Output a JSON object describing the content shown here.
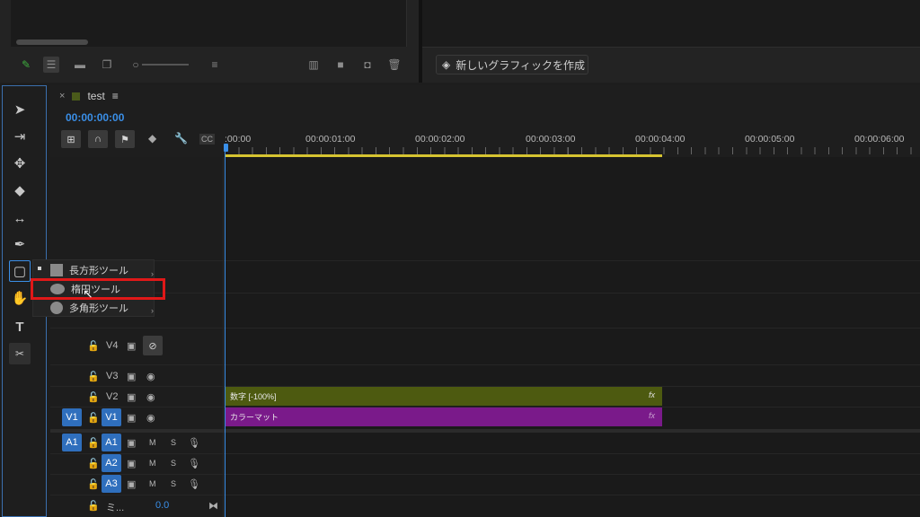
{
  "top_right": {
    "new_graphic_label": "新しいグラフィックを作成"
  },
  "sequence": {
    "tab_name": "test",
    "close": "×",
    "menu": "≡",
    "timecode": "00:00:00:00"
  },
  "ruler": {
    "labels": [
      ":00:00",
      "00:00:01:00",
      "00:00:02:00",
      "00:00:03:00",
      "00:00:04:00",
      "00:00:05:00",
      "00:00:06:00"
    ]
  },
  "tools_flyout": {
    "items": [
      {
        "label": "長方形ツール",
        "icon": "rectangle-icon",
        "selected": true
      },
      {
        "label": "楕円ツール",
        "icon": "ellipse-icon",
        "selected": false
      },
      {
        "label": "多角形ツール",
        "icon": "polygon-icon",
        "selected": false
      }
    ]
  },
  "tracks": {
    "video": [
      {
        "name": "V4",
        "eye_hidden": true
      },
      {
        "name": "V3"
      },
      {
        "name": "V2"
      },
      {
        "name": "V1",
        "source_target": "V1"
      }
    ],
    "audio": [
      {
        "name": "A1",
        "source_target": "A1",
        "m": "M",
        "s": "S"
      },
      {
        "name": "A2",
        "m": "M",
        "s": "S"
      },
      {
        "name": "A3",
        "m": "M",
        "s": "S"
      }
    ],
    "mix": {
      "name": "ミ...",
      "value": "0.0"
    }
  },
  "clips": [
    {
      "label": "数字 [-100%]",
      "fx": "fx",
      "color": "#4d5a10"
    },
    {
      "label": "カラーマット",
      "fx": "fx",
      "color": "#7a1a8a"
    }
  ],
  "colors": {
    "accent": "#3a8fe8",
    "work_area": "#d6c431",
    "highlight": "#e01818"
  }
}
